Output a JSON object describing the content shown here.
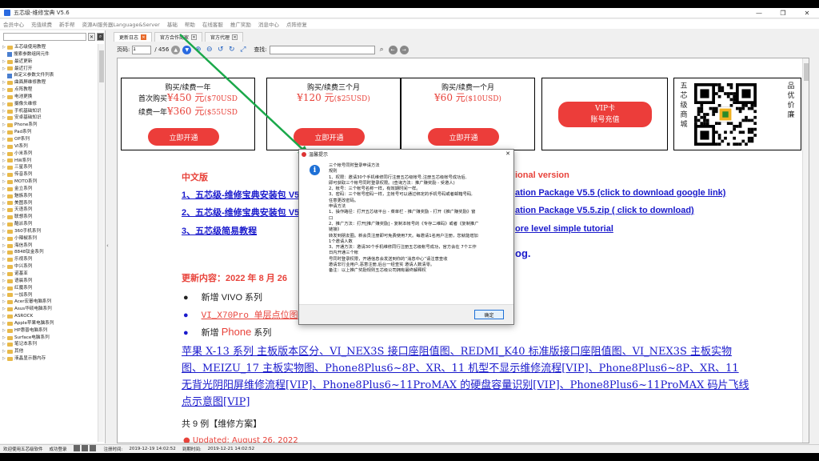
{
  "window": {
    "title": "五芯级-维修宝典 V5.6",
    "min": "—",
    "max": "❐",
    "close": "✕"
  },
  "menu": [
    "会员中心",
    "充值续费",
    "新手帮",
    "资源AI服务器Language&Server",
    "基础",
    "帮助",
    "在线客服",
    "推广奖励",
    "消息中心",
    "点阵修复"
  ],
  "sidebar": {
    "search_placeholder": "",
    "items": [
      {
        "label": "五芯级使用教程",
        "type": "folder"
      },
      {
        "label": "搜索参数组网元件",
        "type": "file"
      },
      {
        "label": "最近更新",
        "type": "folder"
      },
      {
        "label": "最近打开",
        "type": "folder"
      },
      {
        "label": "自定义参数文件列表",
        "type": "file"
      },
      {
        "label": "曲面屏维修教程",
        "type": "folder"
      },
      {
        "label": "点阵教程",
        "type": "folder"
      },
      {
        "label": "电池更换",
        "type": "folder"
      },
      {
        "label": "摄像头维修",
        "type": "folder"
      },
      {
        "label": "手机基础知识",
        "type": "folder"
      },
      {
        "label": "安卓基础知识",
        "type": "folder"
      },
      {
        "label": "Phone系列",
        "type": "folder"
      },
      {
        "label": "Pad系列",
        "type": "folder"
      },
      {
        "label": "OP系列",
        "type": "folder"
      },
      {
        "label": "VI系列",
        "type": "folder"
      },
      {
        "label": "小米系列",
        "type": "folder"
      },
      {
        "label": "HW系列",
        "type": "folder"
      },
      {
        "label": "三星系列",
        "type": "folder"
      },
      {
        "label": "传音系列",
        "type": "folder"
      },
      {
        "label": "MOTO系列",
        "type": "folder"
      },
      {
        "label": "金立系列",
        "type": "folder"
      },
      {
        "label": "魅族系列",
        "type": "folder"
      },
      {
        "label": "美图系列",
        "type": "folder"
      },
      {
        "label": "天语系列",
        "type": "folder"
      },
      {
        "label": "联想系列",
        "type": "folder"
      },
      {
        "label": "酷派系列",
        "type": "folder"
      },
      {
        "label": "360手机系列",
        "type": "folder"
      },
      {
        "label": "小辣椒系列",
        "type": "folder"
      },
      {
        "label": "海信系列",
        "type": "folder"
      },
      {
        "label": "8848钛金系列",
        "type": "folder"
      },
      {
        "label": "乐视系列",
        "type": "folder"
      },
      {
        "label": "中兴系列",
        "type": "folder"
      },
      {
        "label": "诺基亚",
        "type": "folder"
      },
      {
        "label": "语晨系列",
        "type": "folder"
      },
      {
        "label": "红魔系列",
        "type": "folder"
      },
      {
        "label": "一加系列",
        "type": "folder"
      },
      {
        "label": "Acer宏碁电脑系列",
        "type": "folder"
      },
      {
        "label": "Asus华硕电脑系列",
        "type": "folder"
      },
      {
        "label": "ASROCK",
        "type": "folder"
      },
      {
        "label": "Apple苹果电脑系列",
        "type": "folder"
      },
      {
        "label": "HP惠普电脑系列",
        "type": "folder"
      },
      {
        "label": "Surface电脑系列",
        "type": "folder"
      },
      {
        "label": "笔记本系列",
        "type": "folder"
      },
      {
        "label": "其他",
        "type": "folder"
      },
      {
        "label": "液晶显示器内存",
        "type": "folder"
      }
    ]
  },
  "tabs": [
    {
      "label": "更新日志",
      "active": true
    },
    {
      "label": "官方合作商家",
      "active": false
    },
    {
      "label": "官方代理",
      "active": false
    }
  ],
  "toolbar": {
    "page_label": "页码:",
    "page_value": "1",
    "page_total": "/ 456",
    "find_label": "查找:",
    "find_value": ""
  },
  "banner": {
    "yearly": {
      "title": "购买/续费一年",
      "line1a": "首次购买",
      "line1b": "¥450 元",
      "line1c": "($70USD",
      "line2a": "续费一年",
      "line2b": "¥360 元",
      "line2c": "($55USD",
      "button": "立即开通"
    },
    "quarter": {
      "title": "购买/续费三个月",
      "price": "¥120 元",
      "usd": "($25USD)",
      "button": "立即开通"
    },
    "month": {
      "title": "购买/续费一个月",
      "price": "¥60 元",
      "usd": "($10USD)",
      "button": "立即开通"
    },
    "vip": {
      "line1": "VIP卡",
      "line2": "账号充值"
    },
    "shop": {
      "left": [
        "五",
        "芯",
        "级",
        "商",
        "城"
      ],
      "right": [
        "品",
        "优",
        "价",
        "廉"
      ]
    }
  },
  "doc": {
    "cn_heading": "中文版",
    "link1": "1、五芯级-维修宝典安装包 V5",
    "link2": "2、五芯级-维修宝典安装包 V5",
    "link3": "3、五芯级简易教程",
    "en_heading": "ional version",
    "en1": "ation Package V5.5 (click to download google link)",
    "en2": "ation Package V5.5.zip ( click to download)",
    "en3": "ore level simple tutorial",
    "en_blog": "og.",
    "update_title": "更新内容：2022 年 8 月 26",
    "b1": "新增 VIVO 系列",
    "b2": "VI_X70Pro 单层点位图",
    "b3a": "新增",
    "b3b": "Phone",
    "b3c": "系列",
    "para": "苹果 X-13 系列 主板版本区分、VI_NEX3S 接口座阻值图、REDMI_K40 标准版接口座阻值图、VI_NEX3S 主板实物图、MEIZU_17 主板实物图、Phone8Plus6~8P、XR、11 机型不显示维修流程[VIP]、Phone8Plus6~8P、XR、11 无背光阴阳屏维修流程[VIP]、Phone8Plus6~11ProMAX 的硬盘容量识别[VIP]、Phone8Plus6~11ProMAX 码片飞线点示意图[VIP]",
    "count": "共 9 例【维修方案】",
    "cut": "● Updated: August 26, 2022"
  },
  "dialog": {
    "title": "温馨提示",
    "lines": [
      "三个帐号同时登录申请方法",
      "规则",
      "1、权限：邀请30个手机维修同行注册五芯级帐号,注册五芯级帐号成功后,",
      "即可获取三个帐号同时登录权限。(查询方法：推广赚奖励 - 受邀人)",
      "2、帐号：三个帐号名称一样，有效期时间一样。",
      "3、密码：三个帐号密码一样，主帐号可以通过绑定的手机号码或者邮箱号码,",
      "任意更改密码。",
      "申请方法",
      "1、操作路径：打开五芯级平台 - 菜单栏 - 推广赚奖励 - 打开《推广赚奖励》窗",
      "口",
      "2、推广方法：打开[推广赚奖励] - 复制本帐号的《专存二维码》或者《复制推广",
      "链接》",
      "转发到朋友圈。新会员注册即可免费使用7天。每邀请1名用户注册，您就能增加",
      "1个邀请人数",
      "3、开通方法：邀请30个手机维修同行注册五芯级帐号成功，官方会在 7个工作",
      "日内开通三个帐",
      "号同时登录权限，开通信息会发送到你的“消息中心”请注意查收",
      "邀请非行业用户,恶意注册,后台一经查实 邀请人数清零。",
      "备注：以上推广奖励规则五芯级公司拥有最终解释权"
    ],
    "ok": "确定"
  },
  "status": {
    "welcome": "欢迎使用五芯级软件",
    "login": "成功登录",
    "reg_label": "注册时间:",
    "reg": "2019-12-19 14:02:52",
    "exp_label": "到期时间:",
    "exp": "2019-12-21 14:02:52"
  }
}
